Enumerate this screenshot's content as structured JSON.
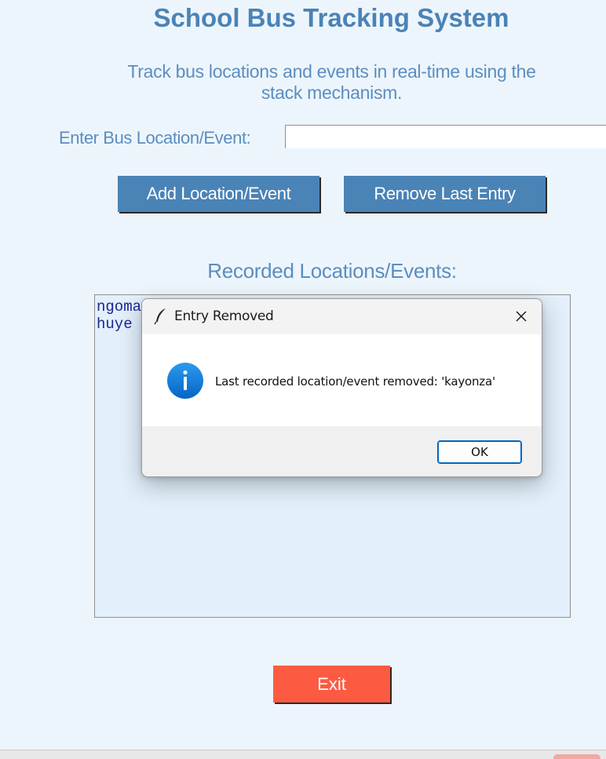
{
  "app": {
    "title": "School Bus Tracking System",
    "subtitle": "Track bus locations and events in real-time using the stack mechanism."
  },
  "entry": {
    "label": "Enter Bus Location/Event:",
    "value": "",
    "placeholder": ""
  },
  "buttons": {
    "add_label": "Add Location/Event",
    "remove_label": "Remove Last Entry",
    "exit_label": "Exit"
  },
  "list": {
    "heading": "Recorded Locations/Events:",
    "items": [
      "ngoma",
      "huye"
    ]
  },
  "dialog": {
    "title": "Entry Removed",
    "message": "Last recorded location/event removed: 'kayonza'",
    "ok_label": "OK",
    "icons": {
      "window": "feather-icon",
      "close": "close-icon",
      "message": "info-icon"
    }
  },
  "colors": {
    "accent": "#4a83b6",
    "exit": "#fd5a42",
    "list_text": "#1d2591",
    "background": "#edf5fc",
    "info_icon": "#0a78d7"
  }
}
